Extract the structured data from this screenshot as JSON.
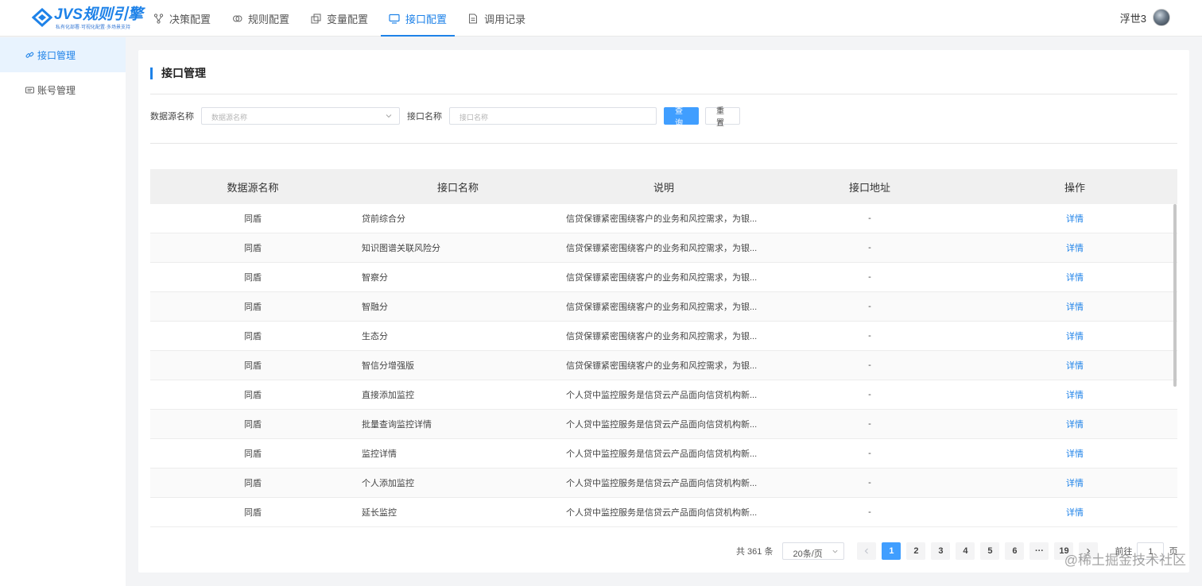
{
  "brand": {
    "title": "JVS规则引擎",
    "subtitle": "私有化部署·可视化配置·多场景支持"
  },
  "nav": {
    "items": [
      {
        "label": "决策配置",
        "icon": "branch-icon"
      },
      {
        "label": "规则配置",
        "icon": "rules-icon"
      },
      {
        "label": "变量配置",
        "icon": "variable-icon"
      },
      {
        "label": "接口配置",
        "icon": "monitor-icon",
        "active": true
      },
      {
        "label": "调用记录",
        "icon": "document-icon"
      }
    ]
  },
  "user": {
    "name": "浮世3"
  },
  "sidebar": {
    "items": [
      {
        "label": "接口管理",
        "icon": "link-icon",
        "active": true
      },
      {
        "label": "账号管理",
        "icon": "id-card-icon"
      }
    ]
  },
  "page": {
    "title": "接口管理"
  },
  "filter": {
    "datasource_label": "数据源名称",
    "datasource_placeholder": "数据源名称",
    "api_label": "接口名称",
    "api_placeholder": "接口名称",
    "query_button": "查询",
    "reset_button": "重置"
  },
  "table": {
    "columns": [
      "数据源名称",
      "接口名称",
      "说明",
      "接口地址",
      "操作"
    ],
    "rows": [
      {
        "source": "同盾",
        "name": "贷前综合分",
        "desc": "信贷保镖紧密围绕客户的业务和风控需求，为银...",
        "url": "-",
        "action": "详情"
      },
      {
        "source": "同盾",
        "name": "知识图谱关联风险分",
        "desc": "信贷保镖紧密围绕客户的业务和风控需求，为银...",
        "url": "-",
        "action": "详情"
      },
      {
        "source": "同盾",
        "name": "智察分",
        "desc": "信贷保镖紧密围绕客户的业务和风控需求，为银...",
        "url": "-",
        "action": "详情"
      },
      {
        "source": "同盾",
        "name": "智融分",
        "desc": "信贷保镖紧密围绕客户的业务和风控需求，为银...",
        "url": "-",
        "action": "详情"
      },
      {
        "source": "同盾",
        "name": "生态分",
        "desc": "信贷保镖紧密围绕客户的业务和风控需求，为银...",
        "url": "-",
        "action": "详情"
      },
      {
        "source": "同盾",
        "name": "智信分增强版",
        "desc": "信贷保镖紧密围绕客户的业务和风控需求，为银...",
        "url": "-",
        "action": "详情"
      },
      {
        "source": "同盾",
        "name": "直接添加监控",
        "desc": "个人贷中监控服务是信贷云产品面向信贷机构新...",
        "url": "-",
        "action": "详情"
      },
      {
        "source": "同盾",
        "name": "批量查询监控详情",
        "desc": "个人贷中监控服务是信贷云产品面向信贷机构新...",
        "url": "-",
        "action": "详情"
      },
      {
        "source": "同盾",
        "name": "监控详情",
        "desc": "个人贷中监控服务是信贷云产品面向信贷机构新...",
        "url": "-",
        "action": "详情"
      },
      {
        "source": "同盾",
        "name": "个人添加监控",
        "desc": "个人贷中监控服务是信贷云产品面向信贷机构新...",
        "url": "-",
        "action": "详情"
      },
      {
        "source": "同盾",
        "name": "延长监控",
        "desc": "个人贷中监控服务是信贷云产品面向信贷机构新...",
        "url": "-",
        "action": "详情"
      }
    ]
  },
  "pagination": {
    "total_text": "共 361 条",
    "page_size": "20条/页",
    "pages": [
      "1",
      "2",
      "3",
      "4",
      "5",
      "6",
      "···",
      "19"
    ],
    "current_page": "1",
    "goto_label": "前往",
    "goto_value": "1",
    "goto_suffix": "页"
  },
  "watermark": "@稀土掘金技术社区",
  "colors": {
    "accent": "#1e82e8",
    "primary_button": "#409eff"
  }
}
